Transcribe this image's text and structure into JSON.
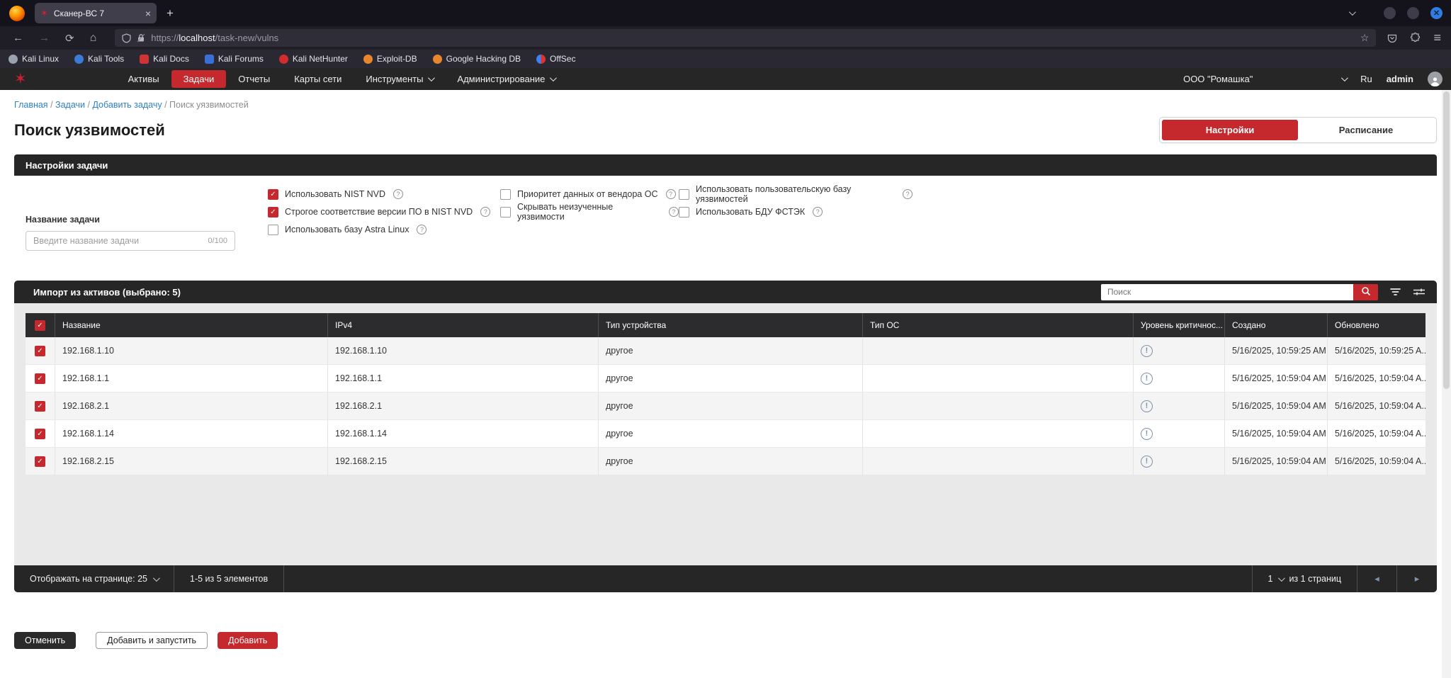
{
  "browser": {
    "tab_title": "Сканер-ВС 7",
    "url_scheme": "https://",
    "url_host": "localhost",
    "url_path": "/task-new/vulns",
    "bookmarks": [
      "Kali Linux",
      "Kali Tools",
      "Kali Docs",
      "Kali Forums",
      "Kali NetHunter",
      "Exploit-DB",
      "Google Hacking DB",
      "OffSec"
    ]
  },
  "nav": {
    "items": [
      "Активы",
      "Задачи",
      "Отчеты",
      "Карты сети",
      "Инструменты",
      "Администрирование"
    ],
    "active_item": "Задачи",
    "org": "ООО \"Ромашка\"",
    "lang": "Ru",
    "user": "admin"
  },
  "breadcrumb": {
    "links": [
      "Главная",
      "Задачи",
      "Добавить задачу"
    ],
    "current": "Поиск уязвимостей",
    "separator": "/"
  },
  "page": {
    "title": "Поиск уязвимостей"
  },
  "view_tabs": {
    "settings": "Настройки",
    "schedule": "Расписание"
  },
  "task_settings": {
    "header": "Настройки задачи",
    "name_label": "Название задачи",
    "name_placeholder": "Введите название задачи",
    "name_counter": "0/100",
    "checkboxes": [
      {
        "label": "Использовать NIST NVD",
        "checked": true
      },
      {
        "label": "Строгое соответствие версии ПО в NIST NVD",
        "checked": true
      },
      {
        "label": "Использовать базу Astra Linux",
        "checked": false
      },
      {
        "label": "Приоритет данных от вендора ОС",
        "checked": false
      },
      {
        "label": "Скрывать неизученные уязвимости",
        "checked": false
      },
      {
        "label": "Использовать пользовательскую базу уязвимостей",
        "checked": false
      },
      {
        "label": "Использовать БДУ ФСТЭК",
        "checked": false
      }
    ]
  },
  "assets_table": {
    "header": "Импорт из активов (выбрано: 5)",
    "search_placeholder": "Поиск",
    "columns": [
      "Название",
      "IPv4",
      "Тип устройства",
      "Тип ОС",
      "Уровень критичнос...",
      "Создано",
      "Обновлено"
    ],
    "rows": [
      {
        "name": "192.168.1.10",
        "ipv4": "192.168.1.10",
        "device_type": "другое",
        "os_type": "",
        "created": "5/16/2025, 10:59:25 AM",
        "updated": "5/16/2025, 10:59:25 A...",
        "checked": true
      },
      {
        "name": "192.168.1.1",
        "ipv4": "192.168.1.1",
        "device_type": "другое",
        "os_type": "",
        "created": "5/16/2025, 10:59:04 AM",
        "updated": "5/16/2025, 10:59:04 A...",
        "checked": true
      },
      {
        "name": "192.168.2.1",
        "ipv4": "192.168.2.1",
        "device_type": "другое",
        "os_type": "",
        "created": "5/16/2025, 10:59:04 AM",
        "updated": "5/16/2025, 10:59:04 A...",
        "checked": true
      },
      {
        "name": "192.168.1.14",
        "ipv4": "192.168.1.14",
        "device_type": "другое",
        "os_type": "",
        "created": "5/16/2025, 10:59:04 AM",
        "updated": "5/16/2025, 10:59:04 A...",
        "checked": true
      },
      {
        "name": "192.168.2.15",
        "ipv4": "192.168.2.15",
        "device_type": "другое",
        "os_type": "",
        "created": "5/16/2025, 10:59:04 AM",
        "updated": "5/16/2025, 10:59:04 A...",
        "checked": true
      }
    ],
    "footer": {
      "per_page_label": "Отображать на странице: 25",
      "range_label": "1-5 из 5 элементов",
      "page_number": "1",
      "pages_label": "из 1 страниц"
    }
  },
  "actions": {
    "cancel": "Отменить",
    "add_and_run": "Добавить и запустить",
    "add": "Добавить"
  },
  "colors": {
    "accent_red": "#c5282d",
    "link_blue": "#2e81c4",
    "dark_bar": "#262626",
    "info_icon": "#7e92ad"
  }
}
